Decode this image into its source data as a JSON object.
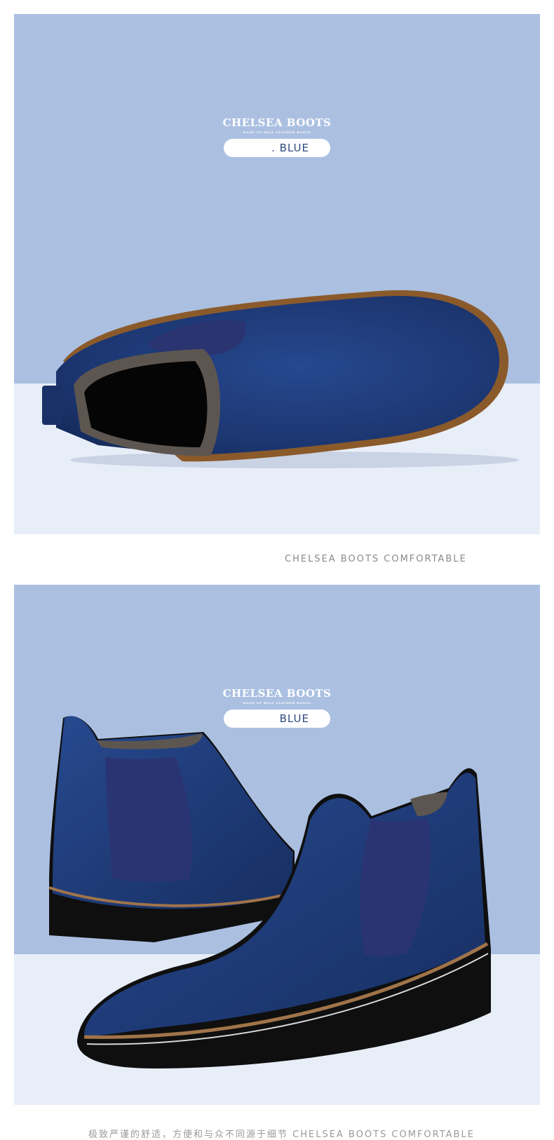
{
  "panel_top": {
    "brand": "CHELSEA BOOTS",
    "brand_sub": "MADE OF REAL LEATHER BOOTS",
    "color_label": ". BLUE"
  },
  "caption_top": "CHELSEA BOOTS COMFORTABLE",
  "panel_bottom": {
    "brand": "CHELSEA BOOTS",
    "brand_sub": "MADE OF REAL LEATHER BOOTS",
    "color_label": "BLUE"
  },
  "caption_bottom": "极致严谨的舒适，方便和与众不同源于细节 CHELSEA BOOTS COMFORTABLE",
  "colors": {
    "backdrop": "#abc0e1",
    "floor": "#e8eef8",
    "suede": "#1e3a7a",
    "text_accent": "#2f4a7f"
  }
}
